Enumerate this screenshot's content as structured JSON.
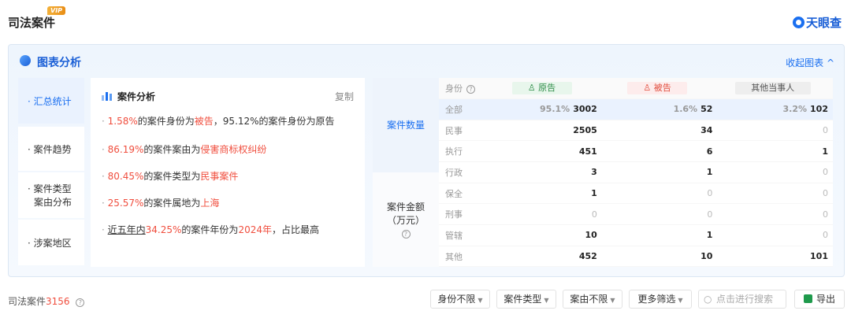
{
  "header": {
    "title": "司法案件",
    "vip": "VIP",
    "brand": "天眼查"
  },
  "panel": {
    "title": "图表分析",
    "collapse": "收起图表 ^",
    "tabs": [
      {
        "lines": [
          "汇总统计"
        ],
        "active": true
      },
      {
        "lines": [
          "案件趋势"
        ]
      },
      {
        "lines": [
          "案件类型",
          "案由分布"
        ]
      },
      {
        "lines": [
          "涉案地区"
        ]
      }
    ],
    "analysis": {
      "title": "案件分析",
      "copy": "复制",
      "lines": [
        {
          "parts": [
            {
              "t": "1.58%",
              "c": "red"
            },
            {
              "t": "的案件身份为"
            },
            {
              "t": "被告",
              "c": "red"
            },
            {
              "t": "，95.12%的案件身份为原告"
            }
          ]
        },
        {
          "parts": [
            {
              "t": "86.19%",
              "c": "red"
            },
            {
              "t": "的案件案由为"
            },
            {
              "t": "侵害商标权纠纷",
              "c": "red"
            }
          ]
        },
        {
          "parts": [
            {
              "t": "80.45%",
              "c": "red"
            },
            {
              "t": "的案件类型为"
            },
            {
              "t": "民事案件",
              "c": "red"
            }
          ]
        },
        {
          "parts": [
            {
              "t": "25.57%",
              "c": "red"
            },
            {
              "t": "的案件属地为"
            },
            {
              "t": "上海",
              "c": "red"
            }
          ]
        },
        {
          "parts": [
            {
              "t": "近五年内",
              "c": "ul"
            },
            {
              "t": "34.25%",
              "c": "red"
            },
            {
              "t": "的案件年份为"
            },
            {
              "t": "2024年",
              "c": "red"
            },
            {
              "t": "，占比最高"
            }
          ]
        }
      ]
    },
    "metrics": {
      "label_count": "案件数量",
      "label_amount": [
        "案件金额",
        "（万元）"
      ],
      "header_label": "身份",
      "columns": [
        "原告",
        "被告",
        "其他当事人"
      ],
      "all_row": {
        "label": "全部",
        "cells": [
          {
            "pct": "95.1%",
            "v": "3002"
          },
          {
            "pct": "1.6%",
            "v": "52"
          },
          {
            "pct": "3.2%",
            "v": "102"
          }
        ]
      },
      "rows": [
        {
          "label": "民事",
          "values": [
            "2505",
            "34",
            "0"
          ]
        },
        {
          "label": "执行",
          "values": [
            "451",
            "6",
            "1"
          ]
        },
        {
          "label": "行政",
          "values": [
            "3",
            "1",
            "0"
          ]
        },
        {
          "label": "保全",
          "values": [
            "1",
            "0",
            "0"
          ]
        },
        {
          "label": "刑事",
          "values": [
            "0",
            "0",
            "0"
          ]
        },
        {
          "label": "管辖",
          "values": [
            "10",
            "1",
            "0"
          ]
        },
        {
          "label": "其他",
          "values": [
            "452",
            "10",
            "101"
          ]
        }
      ]
    }
  },
  "footer": {
    "label": "司法案件",
    "count": "3156",
    "filters": [
      "身份不限",
      "案件类型",
      "案由不限",
      "更多筛选"
    ],
    "search_placeholder": "点击进行搜索",
    "export": "导出"
  },
  "colors": {
    "accent": "#1a6ff0",
    "highlight": "#f04e3e"
  }
}
